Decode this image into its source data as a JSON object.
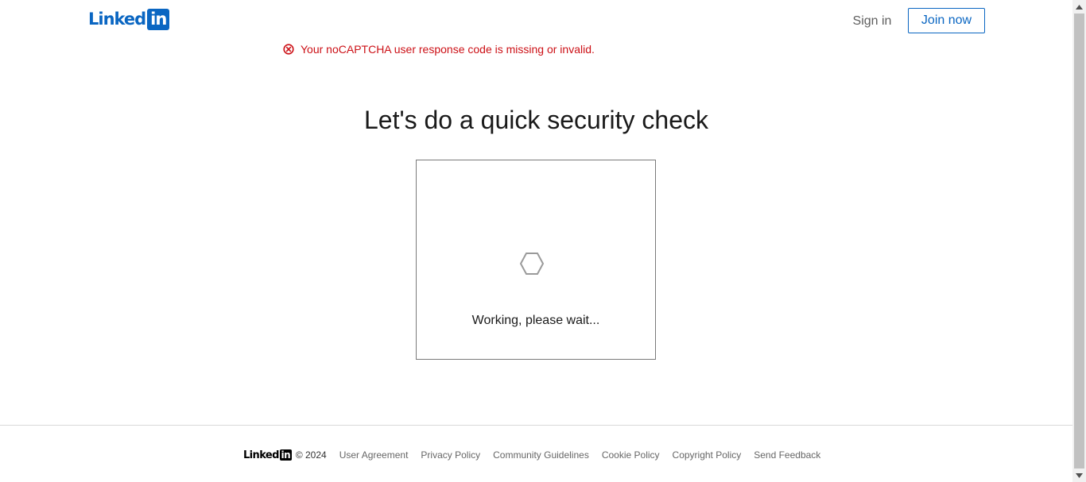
{
  "header": {
    "logo_text": "Linked",
    "logo_box": "in",
    "sign_in_label": "Sign in",
    "join_now_label": "Join now"
  },
  "error": {
    "icon": "error-circle-x-icon",
    "message": "Your noCAPTCHA user response code is missing or invalid."
  },
  "main": {
    "heading": "Let's do a quick security check",
    "captcha": {
      "spinner_icon": "hexagon-spinner-icon",
      "status_text": "Working, please wait..."
    }
  },
  "footer": {
    "logo_text": "Linked",
    "logo_box": "in",
    "copyright": "© 2024",
    "links": [
      "User Agreement",
      "Privacy Policy",
      "Community Guidelines",
      "Cookie Policy",
      "Copyright Policy",
      "Send Feedback"
    ]
  },
  "colors": {
    "brand": "#0a66c2",
    "error": "#cc1016"
  }
}
